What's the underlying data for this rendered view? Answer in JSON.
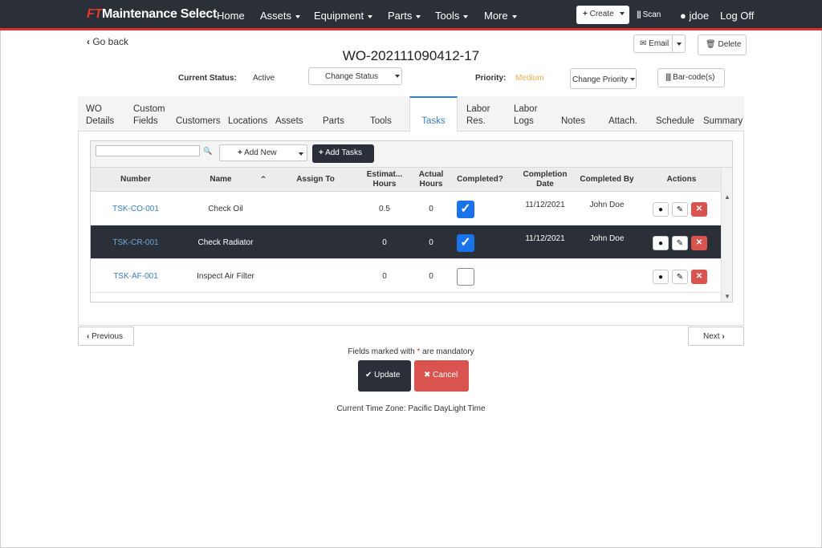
{
  "nav": {
    "brand_prefix": "FT",
    "brand_rest": "Maintenance Select",
    "home": "Home",
    "assets": "Assets",
    "equipment": "Equipment",
    "parts": "Parts",
    "tools": "Tools",
    "more": "More",
    "create": "Create",
    "scan": "Scan",
    "user": "jdoe",
    "logoff": "Log Off"
  },
  "header": {
    "go_back": "Go back",
    "wo_number": "WO-202111090412-17",
    "email": "Email",
    "delete": "Delete",
    "current_status_label": "Current Status:",
    "current_status_value": "Active",
    "change_status": "Change Status",
    "priority_label": "Priority:",
    "priority_value": "Medium",
    "priority_color": "#f0ad4e",
    "change_priority": "Change Priority",
    "barcode": "Bar-code(s)"
  },
  "tabs": [
    {
      "l1": "WO",
      "l2": "Details"
    },
    {
      "l1": "Custom",
      "l2": "Fields"
    },
    {
      "l1": "",
      "l2": "Customers"
    },
    {
      "l1": "",
      "l2": "Locations"
    },
    {
      "l1": "",
      "l2": "Assets"
    },
    {
      "l1": "",
      "l2": "Parts"
    },
    {
      "l1": "",
      "l2": "Tools"
    },
    {
      "l1": "",
      "l2": "Tasks"
    },
    {
      "l1": "Labor",
      "l2": "Res."
    },
    {
      "l1": "Labor",
      "l2": "Logs"
    },
    {
      "l1": "",
      "l2": "Notes"
    },
    {
      "l1": "",
      "l2": "Attach."
    },
    {
      "l1": "",
      "l2": "Schedule"
    },
    {
      "l1": "",
      "l2": "Summary"
    }
  ],
  "toolbar": {
    "search_value": "",
    "add_new": "Add New",
    "add_tasks": "Add Tasks"
  },
  "table": {
    "headers": {
      "number": "Number",
      "name": "Name",
      "assign_to": "Assign To",
      "est_hours_1": "Estimat...",
      "est_hours_2": "Hours",
      "actual_hours_1": "Actual",
      "actual_hours_2": "Hours",
      "completed": "Completed?",
      "completion_date_1": "Completion",
      "completion_date_2": "Date",
      "completed_by": "Completed By",
      "actions": "Actions"
    },
    "rows": [
      {
        "number": "TSK-CO-001",
        "name": "Check Oil",
        "assign_to": "",
        "est": "0.5",
        "actual": "0",
        "completed": true,
        "date": "11/12/2021",
        "by": "John Doe"
      },
      {
        "number": "TSK-CR-001",
        "name": "Check Radiator",
        "assign_to": "",
        "est": "0",
        "actual": "0",
        "completed": true,
        "date": "11/12/2021",
        "by": "John Doe"
      },
      {
        "number": "TSK-AF-001",
        "name": "Inspect Air Filter",
        "assign_to": "",
        "est": "0",
        "actual": "0",
        "completed": false,
        "date": "",
        "by": ""
      }
    ]
  },
  "footer": {
    "previous": "Previous",
    "next": "Next",
    "mandatory_pre": "Fields marked with",
    "mandatory_star": "*",
    "mandatory_post": "are mandatory",
    "update": "Update",
    "cancel": "Cancel",
    "timezone": "Current Time Zone: Pacific DayLight Time"
  }
}
